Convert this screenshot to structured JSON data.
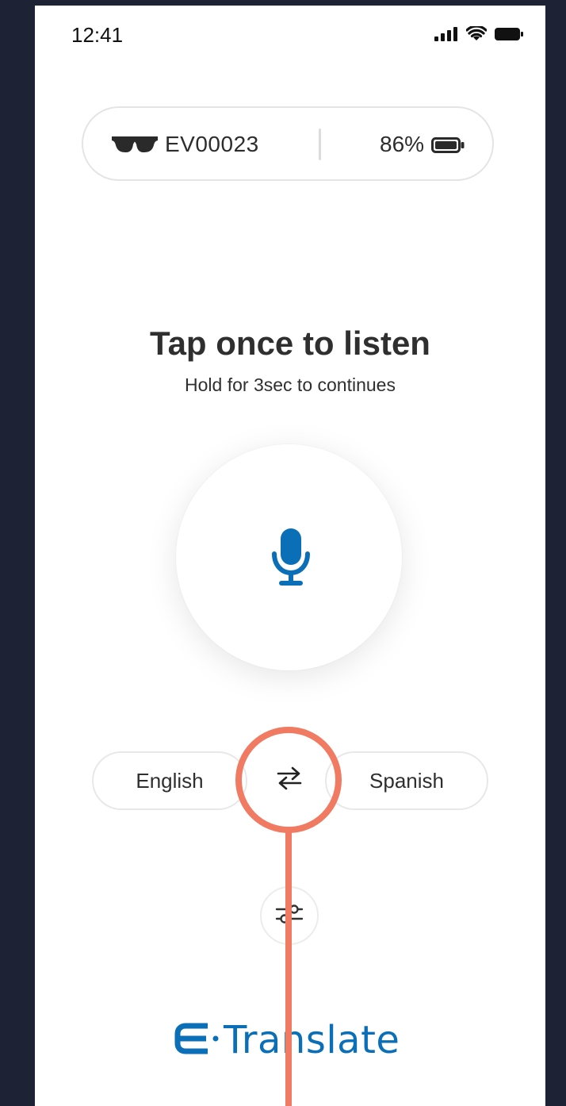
{
  "status_bar": {
    "time": "12:41",
    "icons": [
      "signal-icon",
      "wifi-icon",
      "battery-icon"
    ]
  },
  "device": {
    "icon": "glasses-icon",
    "id": "EV00023",
    "battery_percent": "86%",
    "battery_icon": "battery-icon",
    "battery_level": 0.86
  },
  "prompt": {
    "title": "Tap once to listen",
    "subtitle": "Hold for 3sec to continues"
  },
  "mic": {
    "icon": "microphone-icon",
    "color": "#0b6fb8"
  },
  "languages": {
    "source": "English",
    "target": "Spanish",
    "swap_icon": "swap-arrows-icon"
  },
  "settings": {
    "icon": "sliders-icon"
  },
  "brand": {
    "logo_mark": "E",
    "name": "Translate",
    "color": "#0b6fb8"
  },
  "annotation": {
    "color": "#f07a62"
  }
}
